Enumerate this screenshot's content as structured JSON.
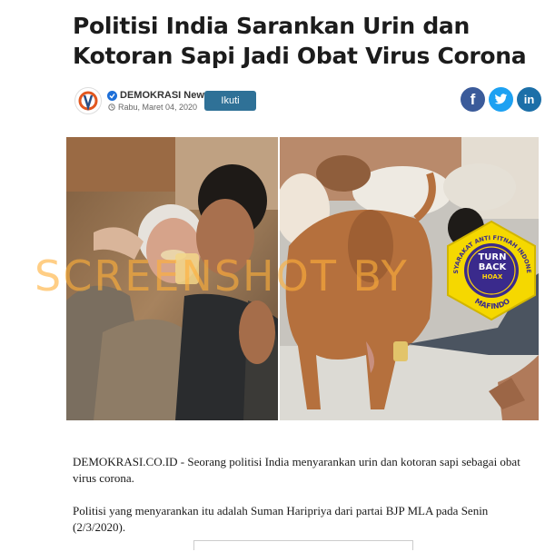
{
  "article": {
    "headline": "Politisi India Sarankan Urin dan Kotoran Sapi Jadi Obat Virus Corona",
    "publisher": "DEMOKRASI News",
    "date": "Rabu, Maret 04, 2020",
    "follow_label": "Ikuti",
    "paragraphs": [
      "DEMOKRASI.CO.ID - Seorang politisi India menyarankan urin dan kotoran sapi sebagai obat virus corona.",
      "Politisi yang menyarankan itu adalah Suman Haripriya dari partai BJP MLA pada Senin (2/3/2020)."
    ]
  },
  "share": {
    "facebook_glyph": "f",
    "twitter_icon": "twitter-bird",
    "linkedin_glyph": "in"
  },
  "overlay": {
    "watermark": "SCREENSHOT BY",
    "badge_title_1": "TURN",
    "badge_title_2": "BACK",
    "badge_title_3": "HOAX",
    "badge_top_arc": "MASYARAKAT ANTI FITNAH INDONESIA",
    "badge_bottom_arc": "MAFINDO"
  },
  "colors": {
    "follow_button": "#2f7197",
    "facebook": "#3b5b9a",
    "twitter": "#1da1f2",
    "linkedin": "#1c6fa8",
    "watermark": "#ffb03a",
    "badge_ring": "#f5d800",
    "badge_center": "#3a2a8c"
  }
}
